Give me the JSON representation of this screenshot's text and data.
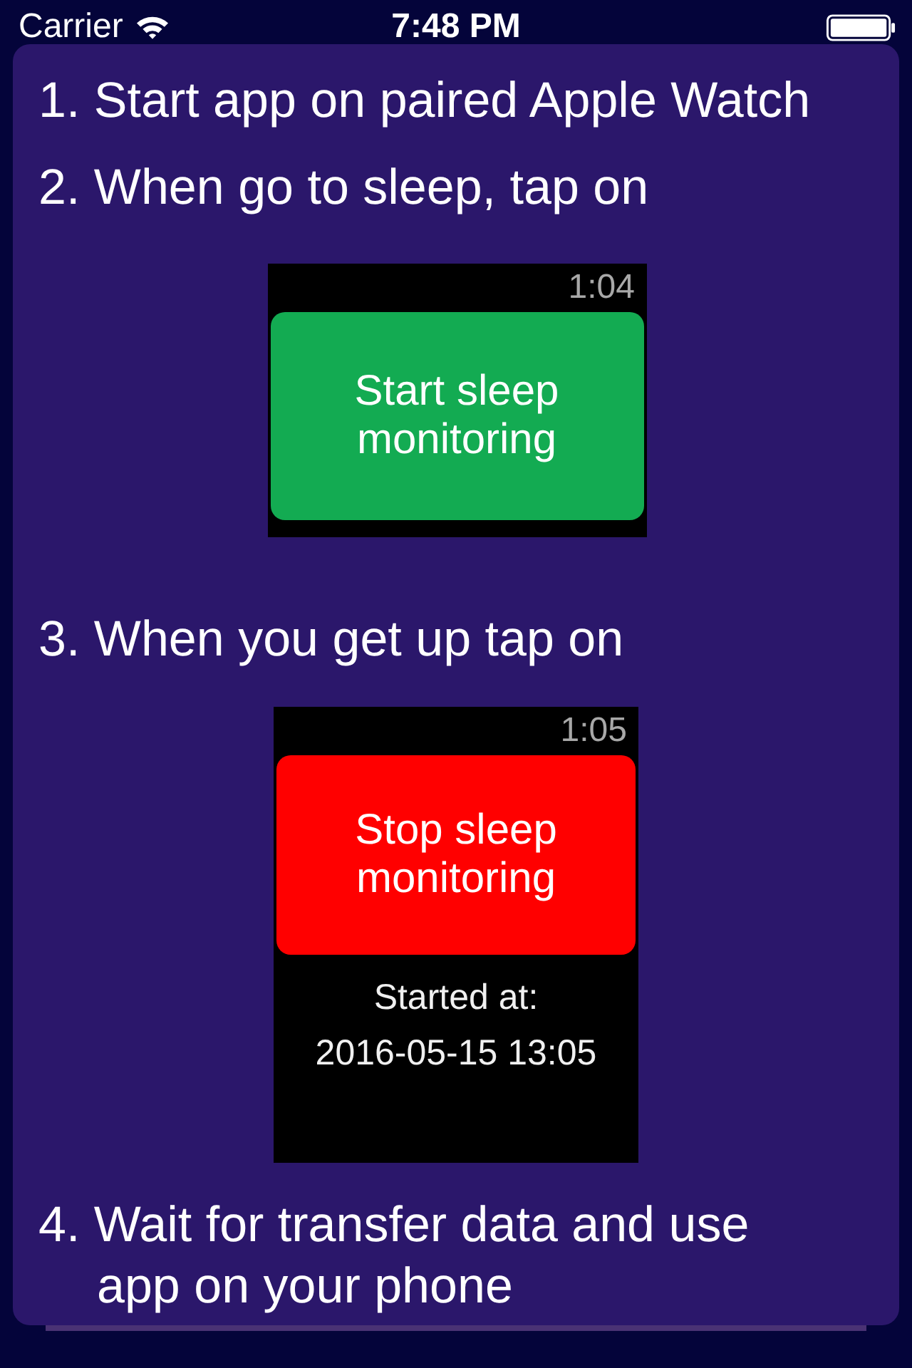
{
  "status_bar": {
    "carrier": "Carrier",
    "time": "7:48 PM"
  },
  "steps": [
    {
      "text": "1. Start app on paired Apple Watch"
    },
    {
      "text": "2. When go to sleep, tap on",
      "watch": {
        "time": "1:04",
        "button": {
          "kind": "start",
          "label": "Start sleep monitoring"
        }
      }
    },
    {
      "text": "3. When you get up tap on",
      "watch": {
        "time": "1:05",
        "button": {
          "kind": "stop",
          "label": "Stop sleep monitoring"
        },
        "details": [
          "Started at:",
          "2016-05-15 13:05"
        ]
      }
    },
    {
      "text": "4. Wait for transfer data and use app on your phone"
    }
  ]
}
